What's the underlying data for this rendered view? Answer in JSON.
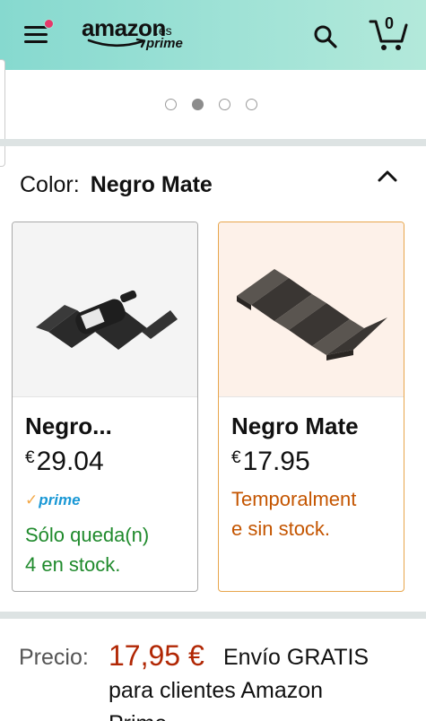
{
  "header": {
    "logo_word": "amazon",
    "logo_tld": ".es",
    "logo_prime": "prime",
    "cart_count": "0"
  },
  "carousel": {
    "dots": 4,
    "active_index": 1
  },
  "color_selector": {
    "label": "Color:",
    "selected": "Negro Mate"
  },
  "options": [
    {
      "title": "Negro...",
      "currency": "€",
      "price": "29.04",
      "prime": "prime",
      "stock_line1": "Sólo queda(n)",
      "stock_line2": "4 en stock."
    },
    {
      "title": "Negro Mate",
      "currency": "€",
      "price": "17.95",
      "stock_line1": "Temporalment",
      "stock_line2": "e sin stock."
    }
  ],
  "price_row": {
    "label": "Precio:",
    "value": "17,95 €",
    "shipping_line1": "Envío GRATIS",
    "shipping_line2": "para clientes Amazon",
    "shipping_line3": "Prime"
  },
  "colors": {
    "header_bg": "#9fe2d6",
    "price": "#b12704",
    "in_stock": "#1f8a2c",
    "out_of_stock": "#c45500",
    "selected_border": "#e8a64c",
    "prime_blue": "#1a98d5"
  }
}
